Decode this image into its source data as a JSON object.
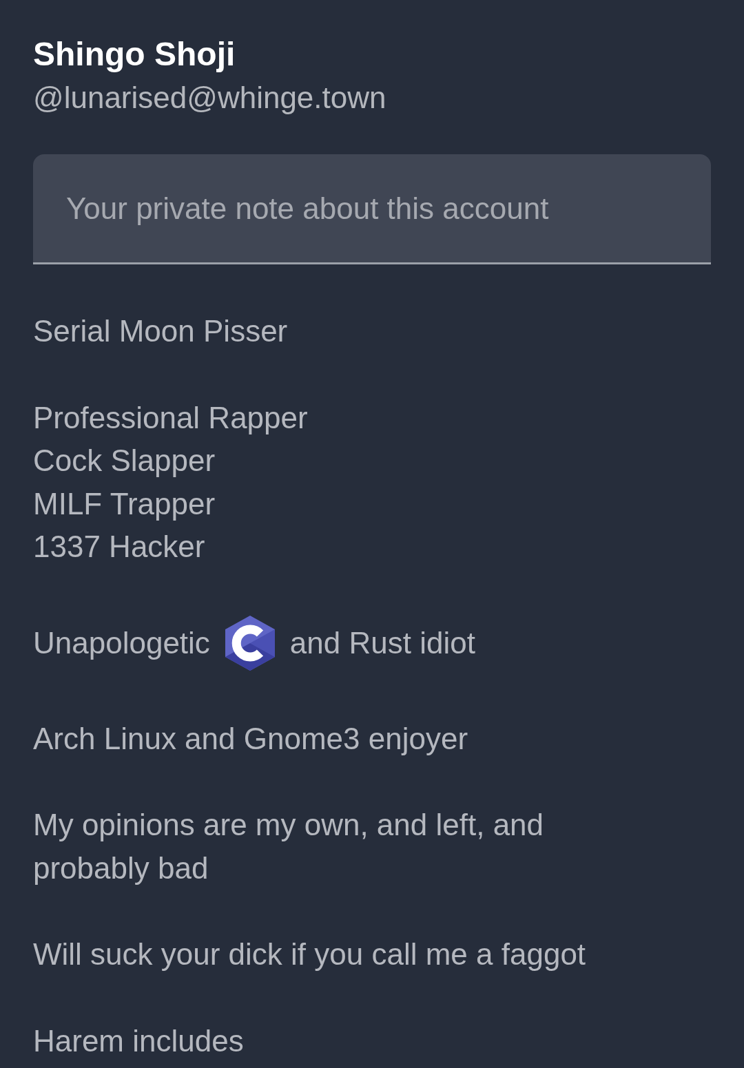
{
  "profile": {
    "display_name": "Shingo Shoji",
    "handle": "@lunarised@whinge.town"
  },
  "note_field": {
    "placeholder": "Your private note about this account"
  },
  "bio": [
    {
      "kind": "lines",
      "lines": [
        "Serial Moon Pisser"
      ]
    },
    {
      "kind": "lines",
      "lines": [
        "Professional Rapper",
        "Cock Slapper",
        "MILF Trapper",
        "1337 Hacker"
      ]
    },
    {
      "kind": "inline",
      "parts": [
        {
          "kind": "text",
          "text": "Unapologetic"
        },
        {
          "kind": "emoji"
        },
        {
          "kind": "text",
          "text": "and Rust idiot"
        }
      ]
    },
    {
      "kind": "lines",
      "lines": [
        "Arch Linux and Gnome3 enjoyer"
      ]
    },
    {
      "kind": "lines",
      "lines": [
        "My opinions are my own, and left, and probably bad"
      ]
    },
    {
      "kind": "lines",
      "lines": [
        "Will suck your dick if you call me a faggot"
      ]
    },
    {
      "kind": "lines",
      "lines": [
        "Harem includes"
      ]
    }
  ]
}
